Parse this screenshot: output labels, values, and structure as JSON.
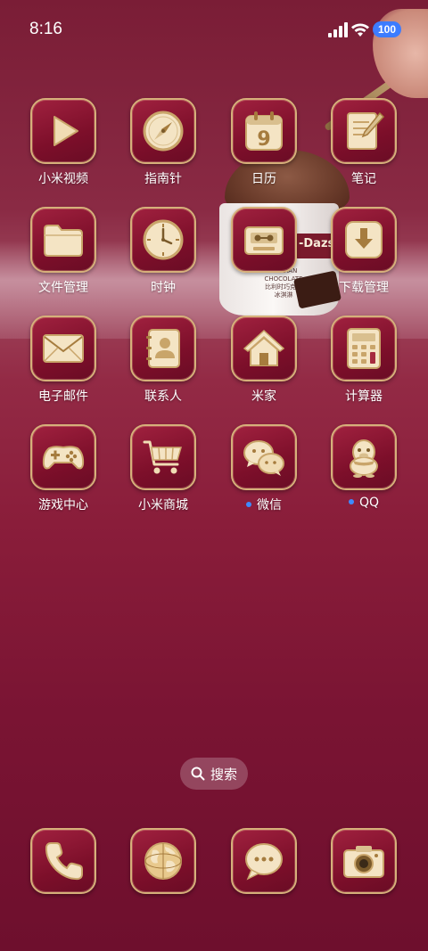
{
  "status_bar": {
    "time": "8:16",
    "battery": "100"
  },
  "wallpaper": {
    "brand_text": "-Dazs",
    "cup_text": "BELGIAN\nCHOCOLATE\n比利时巧克力\n冰淇淋"
  },
  "apps": [
    {
      "label": "小米视频",
      "icon": "play-icon",
      "dot": false
    },
    {
      "label": "指南针",
      "icon": "compass-icon",
      "dot": false
    },
    {
      "label": "日历",
      "icon": "calendar-icon",
      "dot": false,
      "day": "9"
    },
    {
      "label": "笔记",
      "icon": "notes-icon",
      "dot": false
    },
    {
      "label": "文件管理",
      "icon": "folder-icon",
      "dot": false
    },
    {
      "label": "时钟",
      "icon": "clock-icon",
      "dot": false
    },
    {
      "label": "",
      "icon": "radio-icon",
      "dot": false
    },
    {
      "label": "下载管理",
      "icon": "download-icon",
      "dot": false
    },
    {
      "label": "电子邮件",
      "icon": "mail-icon",
      "dot": false
    },
    {
      "label": "联系人",
      "icon": "contacts-icon",
      "dot": false
    },
    {
      "label": "米家",
      "icon": "home-icon",
      "dot": false
    },
    {
      "label": "计算器",
      "icon": "calculator-icon",
      "dot": false
    },
    {
      "label": "游戏中心",
      "icon": "gamepad-icon",
      "dot": false
    },
    {
      "label": "小米商城",
      "icon": "cart-icon",
      "dot": false
    },
    {
      "label": "微信",
      "icon": "wechat-icon",
      "dot": true
    },
    {
      "label": "QQ",
      "icon": "penguin-icon",
      "dot": true
    }
  ],
  "search": {
    "label": "搜索"
  },
  "dock": [
    {
      "icon": "phone-icon"
    },
    {
      "icon": "globe-icon"
    },
    {
      "icon": "message-icon"
    },
    {
      "icon": "camera-icon"
    }
  ],
  "colors": {
    "icon_bg": "#8a1530",
    "gold": "#f0dcb4",
    "gold_dark": "#c9a56a",
    "accent_blue": "#3d7cff"
  }
}
